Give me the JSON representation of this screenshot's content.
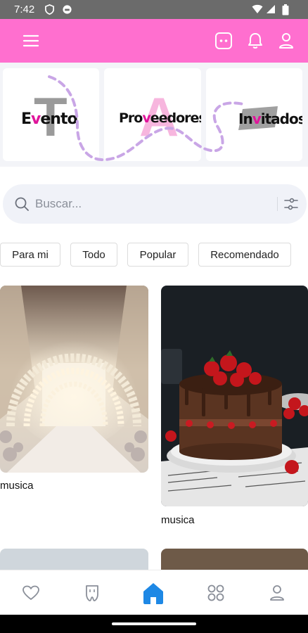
{
  "status_bar": {
    "time": "7:42"
  },
  "app_bar": {
    "menu_icon": "hamburger-menu-icon",
    "actions": [
      "chatbot-icon",
      "bell-icon",
      "user-icon"
    ],
    "background": "#ff6fcf"
  },
  "categories": [
    {
      "label": "Evento",
      "initial": "T",
      "highlight": "v"
    },
    {
      "label": "Proveedores",
      "initial": "A",
      "highlight": "v"
    },
    {
      "label": "Invitados",
      "initial": "",
      "highlight": "v"
    }
  ],
  "search": {
    "placeholder": "Buscar..."
  },
  "filters": [
    "Para mi",
    "Todo",
    "Popular",
    "Recomendado"
  ],
  "cards": [
    {
      "title": "musica",
      "image": "wedding-aisle-arch-photo"
    },
    {
      "title": "musica",
      "image": "chocolate-strawberry-cake-photo"
    }
  ],
  "bottom_nav": [
    "heart-icon",
    "tooth-icon",
    "home-icon",
    "grid-icon",
    "profile-icon"
  ],
  "colors": {
    "accent": "#ff6fcf",
    "active_nav": "#1e88e5",
    "highlight": "#e0159b"
  }
}
